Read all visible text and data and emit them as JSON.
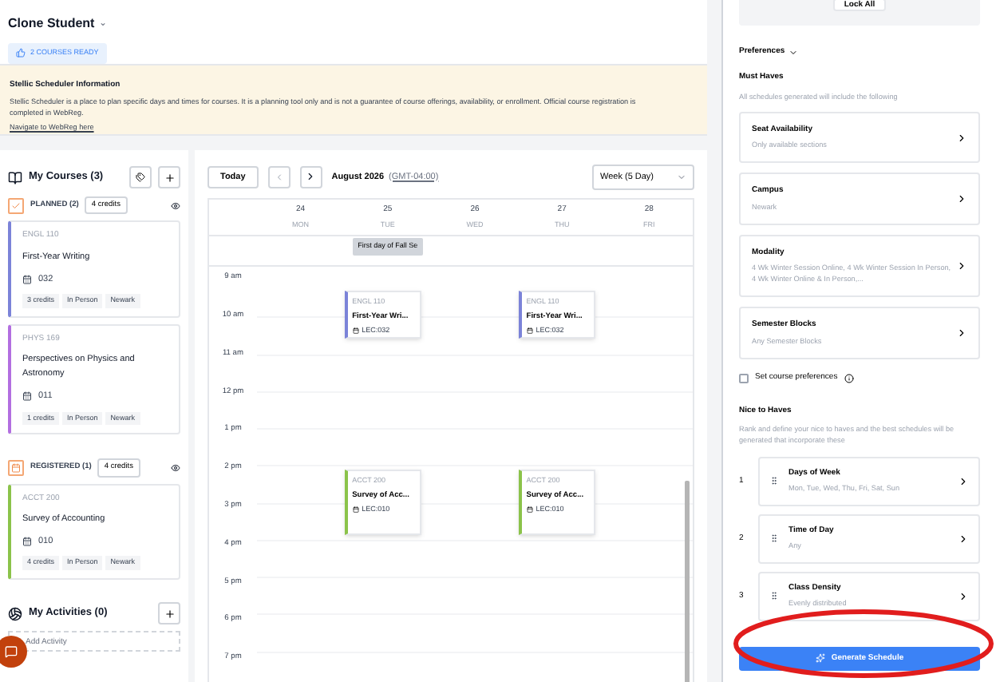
{
  "header": {
    "student": "Clone Student",
    "caret": "⌄",
    "ready_badge": "2 COURSES READY"
  },
  "info": {
    "title": "Stellic Scheduler Information",
    "text": "Stellic Scheduler is a place to plan specific days and times for courses. It is a planning tool only and is not a guarantee of course offerings, availability, or enrollment. Official course registration is completed in WebReg.",
    "link": "Navigate to WebReg here"
  },
  "courses": {
    "title": "My Courses (3)",
    "groups": [
      {
        "kind": "planned",
        "label": "PLANNED (2)",
        "credits": "4 credits",
        "visible": true,
        "items": [
          {
            "code": "ENGL 110",
            "name": "First-Year Writing",
            "section": "032",
            "color": "#7b83d8",
            "tags": [
              "3 credits",
              "In Person",
              "Newark"
            ]
          },
          {
            "code": "PHYS 169",
            "name": "Perspectives on Physics and Astronomy",
            "section": "011",
            "color": "#b26ee0",
            "tags": [
              "1 credits",
              "In Person",
              "Newark"
            ]
          }
        ]
      },
      {
        "kind": "registered",
        "label": "REGISTERED (1)",
        "credits": "4 credits",
        "visible": true,
        "items": [
          {
            "code": "ACCT 200",
            "name": "Survey of Accounting",
            "section": "010",
            "color": "#8bc34a",
            "tags": [
              "4 credits",
              "In Person",
              "Newark"
            ]
          }
        ]
      }
    ]
  },
  "activities": {
    "title": "My Activities (0)",
    "placeholder": "Add Activity"
  },
  "calendar": {
    "today": "Today",
    "month": "August 2026",
    "timezone": "(GMT-04:00)",
    "view": "Week (5 Day)",
    "days": [
      {
        "num": "24",
        "name": "MON"
      },
      {
        "num": "25",
        "name": "TUE",
        "all_day": [
          "First day of Fall Se"
        ],
        "events": [
          {
            "code": "ENGL 110",
            "title": "First-Year Wri...",
            "section": "LEC:032",
            "color": "#7b83d8"
          },
          {
            "code": "ACCT 200",
            "title": "Survey of Acc...",
            "section": "LEC:010",
            "color": "#8bc34a"
          }
        ]
      },
      {
        "num": "26",
        "name": "WED"
      },
      {
        "num": "27",
        "name": "THU",
        "events": [
          {
            "code": "ENGL 110",
            "title": "First-Year Wri...",
            "section": "LEC:032",
            "color": "#7b83d8"
          },
          {
            "code": "ACCT 200",
            "title": "Survey of Acc...",
            "section": "LEC:010",
            "color": "#8bc34a"
          }
        ]
      },
      {
        "num": "28",
        "name": "FRI"
      }
    ],
    "hours": [
      "9 am",
      "10 am",
      "11 am",
      "12 pm",
      "1 pm",
      "2 pm",
      "3 pm",
      "4 pm",
      "5 pm",
      "6 pm",
      "7 pm"
    ]
  },
  "panel": {
    "lock_all": "Lock All",
    "preferences": "Preferences",
    "must_haves": {
      "title": "Must Haves",
      "description": "All schedules generated will include the following",
      "items": [
        {
          "title": "Seat Availability",
          "value": "Only available sections"
        },
        {
          "title": "Campus",
          "value": "Newark"
        },
        {
          "title": "Modality",
          "value": "4 Wk Winter Session Online, 4 Wk Winter Session In Person, 4 Wk Winter Online & In Person,..."
        },
        {
          "title": "Semester Blocks",
          "value": "Any Semester Blocks"
        }
      ]
    },
    "course_prefs": {
      "label": "Set course preferences",
      "checked": false
    },
    "nice_to_haves": {
      "title": "Nice to Haves",
      "description": "Rank and define your nice to haves and the best schedules will be generated that incorporate these",
      "items": [
        {
          "rank": "1",
          "title": "Days of Week",
          "value": "Mon, Tue, Wed, Thu, Fri, Sat, Sun"
        },
        {
          "rank": "2",
          "title": "Time of Day",
          "value": "Any"
        },
        {
          "rank": "3",
          "title": "Class Density",
          "value": "Evenly distributed"
        }
      ]
    },
    "generate": "Generate Schedule"
  }
}
